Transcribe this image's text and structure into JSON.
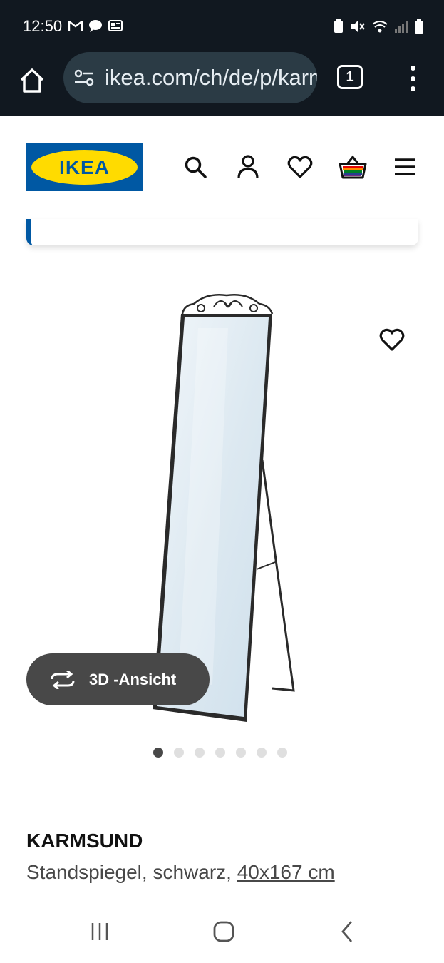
{
  "status_bar": {
    "time": "12:50"
  },
  "browser": {
    "url": "ikea.com/ch/de/p/karmsund",
    "tab_count": "1"
  },
  "header": {
    "logo_text": "IKEA",
    "brand_colors": {
      "blue": "#0058a3",
      "yellow": "#ffdb00"
    },
    "icons": [
      "search-icon",
      "profile-icon",
      "heart-icon",
      "shopping-bag-icon",
      "hamburger-menu-icon"
    ]
  },
  "gallery": {
    "view3d_label": "3D -Ansicht",
    "image_count": 7,
    "active_index": 0
  },
  "product": {
    "name": "KARMSUND",
    "description": "Standspiegel, schwarz,",
    "size": "40x167 cm"
  },
  "navigation": {
    "buttons": [
      "recent-apps",
      "home",
      "back"
    ]
  }
}
